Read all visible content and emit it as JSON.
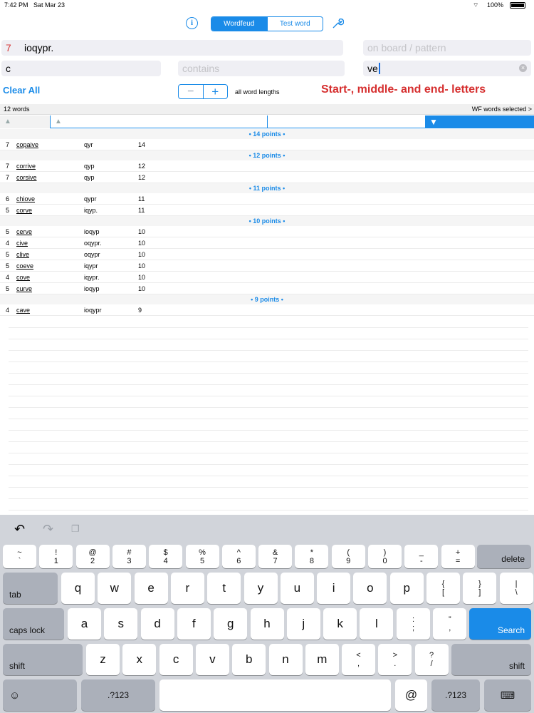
{
  "status": {
    "time": "7:42 PM",
    "date": "Sat Mar 23",
    "battery": "100%"
  },
  "header": {
    "tabs": [
      "Wordfeud",
      "Test word"
    ]
  },
  "inputs": {
    "count": "7",
    "rack": "ioqypr.",
    "pattern_placeholder": "on board / pattern",
    "start": "c",
    "contains_placeholder": "contains",
    "end": "ve"
  },
  "controls": {
    "clear": "Clear All",
    "lengths": "all word lengths",
    "banner": "Start-, middle- and end- letters"
  },
  "results": {
    "count": "12 words",
    "selector": "WF words selected >"
  },
  "groups": [
    {
      "label": "• 14 points •",
      "rows": [
        {
          "len": "7",
          "word": "copaive",
          "rack": "qyr",
          "pts": "14"
        }
      ]
    },
    {
      "label": "• 12 points •",
      "rows": [
        {
          "len": "7",
          "word": "corrive",
          "rack": "qyp",
          "pts": "12"
        },
        {
          "len": "7",
          "word": "corsive",
          "rack": "qyp",
          "pts": "12"
        }
      ]
    },
    {
      "label": "• 11 points •",
      "rows": [
        {
          "len": "6",
          "word": "chiove",
          "rack": "qypr",
          "pts": "11"
        },
        {
          "len": "5",
          "word": "corve",
          "rack": "iqyp.",
          "pts": "11"
        }
      ]
    },
    {
      "label": "• 10 points •",
      "rows": [
        {
          "len": "5",
          "word": "cerve",
          "rack": "ioqyp",
          "pts": "10"
        },
        {
          "len": "4",
          "word": "cive",
          "rack": "oqypr.",
          "pts": "10"
        },
        {
          "len": "5",
          "word": "clive",
          "rack": "oqypr",
          "pts": "10"
        },
        {
          "len": "5",
          "word": "coeve",
          "rack": "iqypr",
          "pts": "10"
        },
        {
          "len": "4",
          "word": "cove",
          "rack": "iqypr.",
          "pts": "10"
        },
        {
          "len": "5",
          "word": "curve",
          "rack": "ioqyp",
          "pts": "10"
        }
      ]
    },
    {
      "label": "• 9 points •",
      "rows": [
        {
          "len": "4",
          "word": "cave",
          "rack": "ioqypr",
          "pts": "9"
        }
      ]
    }
  ],
  "keyboard": {
    "num": [
      [
        "~",
        "`"
      ],
      [
        "!",
        "1"
      ],
      [
        "@",
        "2"
      ],
      [
        "#",
        "3"
      ],
      [
        "$",
        "4"
      ],
      [
        "%",
        "5"
      ],
      [
        "^",
        "6"
      ],
      [
        "&",
        "7"
      ],
      [
        "*",
        "8"
      ],
      [
        "(",
        "9"
      ],
      [
        ")",
        "0"
      ],
      [
        "_",
        "-"
      ],
      [
        "+",
        "="
      ]
    ],
    "row1": [
      "q",
      "w",
      "e",
      "r",
      "t",
      "y",
      "u",
      "i",
      "o",
      "p"
    ],
    "row1sym": [
      [
        "{",
        "["
      ],
      [
        "}",
        "]"
      ],
      [
        "|",
        "\\"
      ]
    ],
    "row2": [
      "a",
      "s",
      "d",
      "f",
      "g",
      "h",
      "j",
      "k",
      "l"
    ],
    "row2sym": [
      [
        ":",
        ";"
      ],
      [
        "”",
        ","
      ]
    ],
    "row3": [
      "z",
      "x",
      "c",
      "v",
      "b",
      "n",
      "m"
    ],
    "row3sym": [
      [
        "<",
        ","
      ],
      [
        ">",
        "."
      ],
      [
        "?",
        "/"
      ]
    ],
    "delete": "delete",
    "tab": "tab",
    "caps": "caps lock",
    "search": "Search",
    "shift": "shift",
    "num_mode": ".?123",
    "at": "@"
  }
}
